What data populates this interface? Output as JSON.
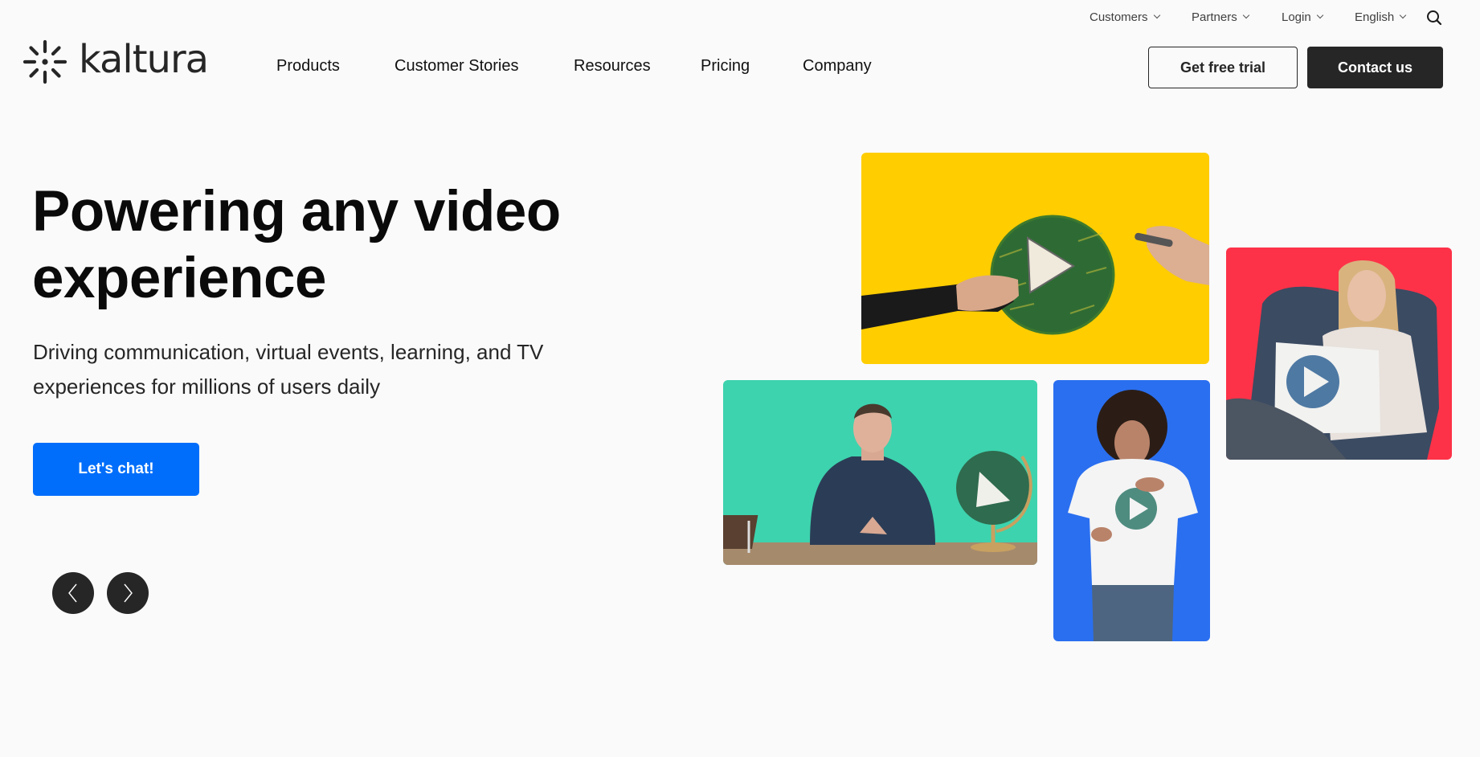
{
  "brand": {
    "name": "kaltura",
    "logo_icon": "starburst-logo-icon"
  },
  "utility_nav": {
    "items": [
      {
        "label": "Customers",
        "icon": "chevron-down-icon"
      },
      {
        "label": "Partners",
        "icon": "chevron-down-icon"
      },
      {
        "label": "Login",
        "icon": "chevron-down-icon"
      },
      {
        "label": "English",
        "icon": "chevron-down-icon"
      }
    ],
    "search_icon": "search-icon"
  },
  "main_nav": {
    "items": [
      {
        "label": "Products"
      },
      {
        "label": "Customer Stories"
      },
      {
        "label": "Resources"
      },
      {
        "label": "Pricing"
      },
      {
        "label": "Company"
      }
    ],
    "free_trial_label": "Get free trial",
    "contact_label": "Contact us"
  },
  "hero": {
    "title": "Powering any video experience",
    "subtitle": "Driving communication, virtual events, learning, and TV experiences for millions of users daily",
    "cta_label": "Let's chat!",
    "prev_icon": "chevron-left-icon",
    "next_icon": "chevron-right-icon"
  },
  "media_cards": [
    {
      "name": "hands-drawing-play-button",
      "background": "#ffcd00"
    },
    {
      "name": "presenter-at-desk-with-globe",
      "background": "#3dd3ae"
    },
    {
      "name": "woman-play-shirt",
      "background": "#2a6ff0"
    },
    {
      "name": "woman-with-play-pillow",
      "background": "#fd3248"
    }
  ],
  "colors": {
    "background": "#fafafa",
    "text": "#262626",
    "cta_blue": "#006efa",
    "dark_button": "#262626"
  }
}
